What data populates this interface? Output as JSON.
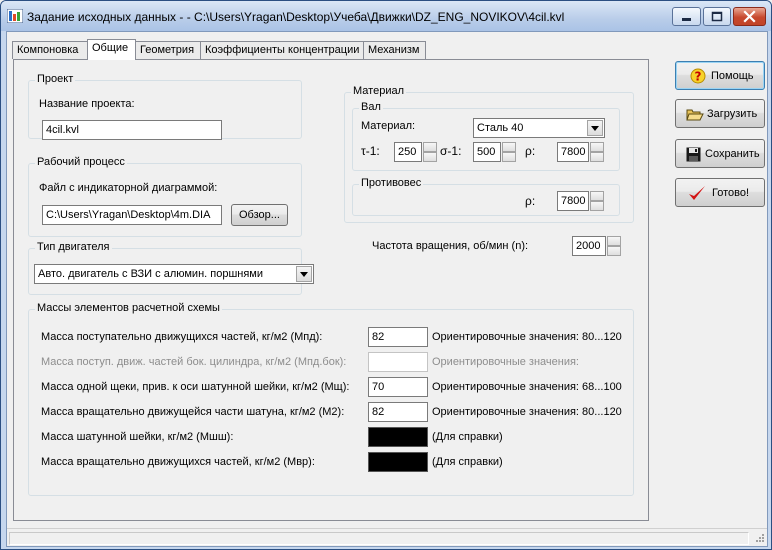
{
  "window": {
    "title": "Задание исходных данных -  - C:\\Users\\Yragan\\Desktop\\Учеба\\Движки\\DZ_ENG_NOVIKOV\\4cil.kvl"
  },
  "tabs": [
    {
      "label": "Компоновка",
      "active": false
    },
    {
      "label": "Общие",
      "active": true
    },
    {
      "label": "Геометрия",
      "active": false
    },
    {
      "label": "Коэффициенты концентрации",
      "active": false
    },
    {
      "label": "Механизм",
      "active": false
    }
  ],
  "project": {
    "legend": "Проект",
    "name_label": "Название проекта:",
    "name_value": "4cil.kvl"
  },
  "workflow": {
    "legend": "Рабочий процесс",
    "file_label": "Файл с индикаторной диаграммой:",
    "file_value": "C:\\Users\\Yragan\\Desktop\\4m.DIA",
    "browse_label": "Обзор..."
  },
  "engine_type": {
    "legend": "Тип двигателя",
    "selected": "Авто. двигатель с ВЗИ с алюмин. поршнями"
  },
  "material": {
    "legend": "Материал",
    "shaft": {
      "legend": "Вал",
      "material_label": "Материал:",
      "material_value": "Сталь 40",
      "tau_label": "τ-1:",
      "tau_value": "250",
      "sigma_label": "σ-1:",
      "sigma_value": "500",
      "rho_label": "ρ:",
      "rho_value": "7800"
    },
    "counterweight": {
      "legend": "Противовес",
      "rho_label": "ρ:",
      "rho_value": "7800"
    }
  },
  "rpm": {
    "label": "Частота вращения, об/мин (n):",
    "value": "2000"
  },
  "masses": {
    "legend": "Массы элементов расчетной схемы",
    "rows": [
      {
        "label": "Масса поступательно  движущихся частей, кг/м2 (Мпд):",
        "value": "82",
        "hint": "Ориентировочные значения: 80...120",
        "state": "normal"
      },
      {
        "label": "Масса поступ.  движ. частей бок. цилиндра, кг/м2 (Мпд.бок):",
        "value": "",
        "hint": "Ориентировочные значения:",
        "state": "disabled"
      },
      {
        "label": "Масса одной щеки, прив. к оси шатунной шейки,  кг/м2 (Мщ):",
        "value": "70",
        "hint": "Ориентировочные значения: 68...100",
        "state": "normal"
      },
      {
        "label": "Масса вращательно  движущейся части шатуна, кг/м2 (М2):",
        "value": "82",
        "hint": "Ориентировочные значения: 80...120",
        "state": "normal"
      },
      {
        "label": "Масса шатунной шейки, кг/м2 (Мшш):",
        "value": "",
        "hint": "(Для справки)",
        "state": "readonly"
      },
      {
        "label": "Масса вращательно  движущихся частей, кг/м2 (Мвр):",
        "value": "",
        "hint": "(Для справки)",
        "state": "readonly"
      }
    ]
  },
  "side_buttons": {
    "help": "Помощь",
    "load": "Загрузить",
    "save": "Сохранить",
    "done": "Готово!"
  },
  "colors": {
    "title_bar": "#b9cde9",
    "close_button": "#c7482d",
    "done_check": "#d21414"
  }
}
